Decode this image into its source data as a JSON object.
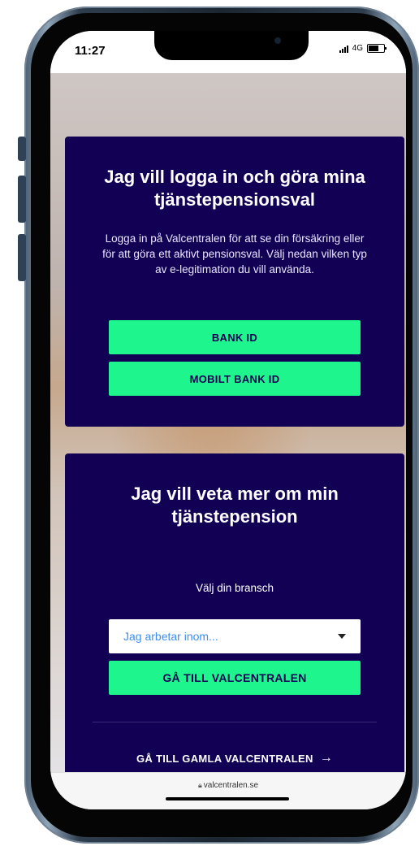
{
  "status": {
    "time": "11:27",
    "network": "4G"
  },
  "login_card": {
    "title": "Jag vill logga in och göra mina tjänstepensionsval",
    "description": "Logga in på Valcentralen för att se din försäkring eller för att göra ett aktivt pensionsval. Välj nedan vilken typ av e-legitimation du vill använda.",
    "bankid_label": "BANK ID",
    "mobilt_bankid_label": "MOBILT BANK ID"
  },
  "info_card": {
    "title": "Jag vill veta mer om min tjänstepension",
    "branch_label": "Välj din bransch",
    "select_placeholder": "Jag arbetar inom...",
    "go_button_label": "GÅ TILL VALCENTRALEN",
    "old_link_label": "GÅ TILL GAMLA VALCENTRALEN",
    "old_link_arrow": "→"
  },
  "browser": {
    "url": "valcentralen.se"
  },
  "colors": {
    "card_bg": "#120055",
    "accent_green": "#1ff58d",
    "select_text": "#3d8ef5"
  }
}
